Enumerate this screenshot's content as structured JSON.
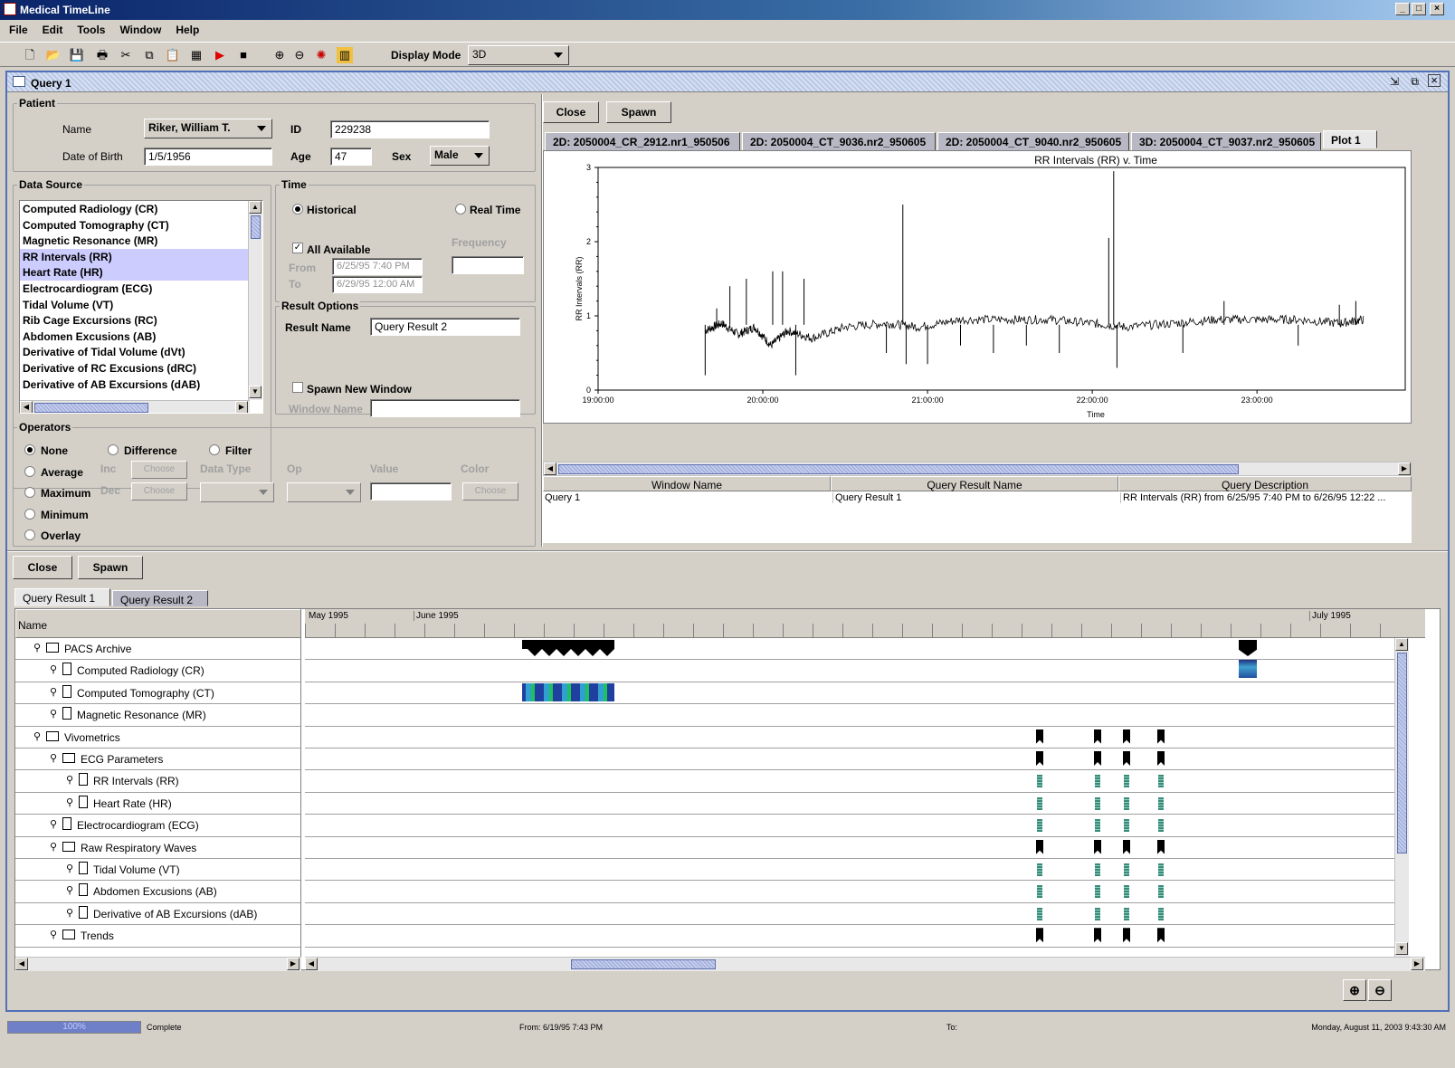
{
  "window": {
    "title": "Medical TimeLine"
  },
  "menu": [
    "File",
    "Edit",
    "Tools",
    "Window",
    "Help"
  ],
  "toolbar": {
    "display_mode_label": "Display Mode",
    "display_mode_value": "3D"
  },
  "frame": {
    "title": "Query 1"
  },
  "patient": {
    "group": "Patient",
    "name_label": "Name",
    "name": "Riker, William T.",
    "id_label": "ID",
    "id": "229238",
    "dob_label": "Date of Birth",
    "dob": "1/5/1956",
    "age_label": "Age",
    "age": "47",
    "sex_label": "Sex",
    "sex": "Male"
  },
  "datasource": {
    "group": "Data Source",
    "items": [
      "Computed Radiology (CR)",
      "Computed Tomography (CT)",
      "Magnetic Resonance (MR)",
      "RR Intervals (RR)",
      "Heart Rate (HR)",
      "Electrocardiogram (ECG)",
      "Tidal Volume (VT)",
      "Rib Cage Excursions (RC)",
      "Abdomen Excusions (AB)",
      "Derivative of Tidal Volume (dVt)",
      "Derivative of RC Excusions (dRC)",
      "Derivative of AB Excursions (dAB)"
    ],
    "selected": [
      3,
      4
    ]
  },
  "time": {
    "group": "Time",
    "historical": "Historical",
    "realtime": "Real Time",
    "all_available": "All Available",
    "frequency": "Frequency",
    "from_label": "From",
    "from": "6/25/95 7:40 PM",
    "to_label": "To",
    "to": "6/29/95 12:00 AM"
  },
  "result_options": {
    "group": "Result Options",
    "name_label": "Result Name",
    "name": "Query Result 2",
    "spawn_new": "Spawn New Window",
    "window_name_label": "Window Name"
  },
  "operators": {
    "group": "Operators",
    "none": "None",
    "difference": "Difference",
    "filter": "Filter",
    "average": "Average",
    "maximum": "Maximum",
    "minimum": "Minimum",
    "overlay": "Overlay",
    "inc": "Inc",
    "dec": "Dec",
    "choose": "Choose",
    "data_type": "Data Type",
    "op": "Op",
    "value": "Value",
    "color": "Color"
  },
  "right": {
    "close": "Close",
    "spawn": "Spawn",
    "tabs": [
      "2D: 2050004_CR_2912.nr1_950506",
      "2D: 2050004_CT_9036.nr2_950605",
      "2D: 2050004_CT_9040.nr2_950605",
      "3D: 2050004_CT_9037.nr2_950605",
      "Plot 1"
    ]
  },
  "chart_data": {
    "type": "line",
    "title": "RR Intervals (RR) v. Time",
    "xlabel": "Time",
    "ylabel": "RR Intervals (RR)",
    "yticks": [
      "0",
      "1",
      "2",
      "3"
    ],
    "xticks": [
      "19:00:00",
      "20:00:00",
      "21:00:00",
      "22:00:00",
      "23:00:00"
    ],
    "ylim": [
      0,
      3
    ],
    "series": [
      {
        "values": [
          [
            19.65,
            0.8
          ],
          [
            19.75,
            0.9
          ],
          [
            19.85,
            0.75
          ],
          [
            19.95,
            0.85
          ],
          [
            20.05,
            0.6
          ],
          [
            20.15,
            0.8
          ],
          [
            20.3,
            0.7
          ],
          [
            20.5,
            0.85
          ],
          [
            20.75,
            0.9
          ],
          [
            20.95,
            0.85
          ],
          [
            21.2,
            0.95
          ],
          [
            21.5,
            0.95
          ],
          [
            21.75,
            0.95
          ],
          [
            22.0,
            0.9
          ],
          [
            22.2,
            0.85
          ],
          [
            22.5,
            0.9
          ],
          [
            22.75,
            0.95
          ],
          [
            23.0,
            0.95
          ],
          [
            23.25,
            0.95
          ],
          [
            23.5,
            0.9
          ],
          [
            23.65,
            0.95
          ]
        ]
      }
    ],
    "spikes": [
      [
        19.65,
        0.2
      ],
      [
        19.72,
        1.1
      ],
      [
        19.8,
        1.4
      ],
      [
        19.9,
        1.5
      ],
      [
        20.06,
        1.6
      ],
      [
        20.12,
        1.6
      ],
      [
        20.2,
        0.2
      ],
      [
        20.25,
        1.5
      ],
      [
        20.75,
        0.5
      ],
      [
        20.85,
        2.5
      ],
      [
        20.87,
        0.35
      ],
      [
        21.0,
        0.35
      ],
      [
        21.2,
        0.6
      ],
      [
        21.4,
        0.5
      ],
      [
        21.6,
        0.6
      ],
      [
        21.8,
        0.5
      ],
      [
        22.1,
        2.05
      ],
      [
        22.13,
        2.95
      ],
      [
        22.15,
        0.3
      ],
      [
        22.55,
        0.5
      ],
      [
        22.8,
        1.2
      ],
      [
        23.25,
        0.6
      ],
      [
        23.5,
        1.15
      ],
      [
        23.6,
        1.2
      ]
    ]
  },
  "results_table": {
    "headers": [
      "Window Name",
      "Query Result Name",
      "Query Description"
    ],
    "row": [
      "Query 1",
      "Query Result 1",
      "RR Intervals (RR) from 6/25/95 7:40 PM to 6/26/95 12:22 ..."
    ]
  },
  "bottom": {
    "close": "Close",
    "spawn": "Spawn",
    "tabs": [
      "Query Result 1",
      "Query Result 2"
    ],
    "name_header": "Name",
    "months": [
      "May 1995",
      "June 1995",
      "July 1995"
    ],
    "tree": [
      {
        "label": "PACS Archive",
        "level": 0,
        "type": "folder"
      },
      {
        "label": "Computed Radiology (CR)",
        "level": 1,
        "type": "doc"
      },
      {
        "label": "Computed Tomography (CT)",
        "level": 1,
        "type": "doc"
      },
      {
        "label": "Magnetic Resonance (MR)",
        "level": 1,
        "type": "doc"
      },
      {
        "label": "Vivometrics",
        "level": 0,
        "type": "folder"
      },
      {
        "label": "ECG Parameters",
        "level": 1,
        "type": "folder"
      },
      {
        "label": "RR Intervals (RR)",
        "level": 2,
        "type": "doc"
      },
      {
        "label": "Heart Rate (HR)",
        "level": 2,
        "type": "doc"
      },
      {
        "label": "Electrocardiogram (ECG)",
        "level": 1,
        "type": "doc"
      },
      {
        "label": "Raw Respiratory Waves",
        "level": 1,
        "type": "folder"
      },
      {
        "label": "Tidal Volume (VT)",
        "level": 2,
        "type": "doc"
      },
      {
        "label": "Abdomen Excusions (AB)",
        "level": 2,
        "type": "doc"
      },
      {
        "label": "Derivative of AB Excursions (dAB)",
        "level": 2,
        "type": "doc"
      },
      {
        "label": "Trends",
        "level": 1,
        "type": "folder"
      }
    ]
  },
  "status": {
    "progress": "100%",
    "state": "Complete",
    "from": "From:  6/19/95 7:43 PM",
    "to": "To:",
    "datetime": "Monday, August 11, 2003 9:43:30 AM"
  }
}
